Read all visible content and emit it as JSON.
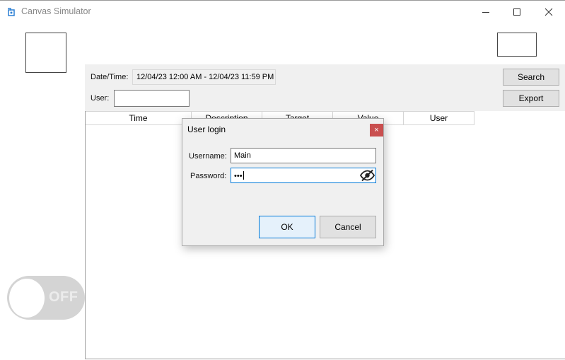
{
  "window": {
    "title": "Canvas Simulator",
    "icons": {
      "app": "app-icon",
      "minimize": "minimize-icon",
      "maximize": "maximize-icon",
      "close": "close-icon"
    }
  },
  "filters": {
    "datetime_label": "Date/Time:",
    "datetime_value": "12/04/23 12:00 AM - 12/04/23 11:59 PM",
    "user_label": "User:",
    "user_value": ""
  },
  "buttons": {
    "search": "Search",
    "export": "Export"
  },
  "table": {
    "columns": [
      "Time",
      "Description",
      "Target",
      "Value",
      "User"
    ],
    "rows": []
  },
  "toggle": {
    "label": "OFF",
    "state": "off"
  },
  "dialog": {
    "title": "User login",
    "close_glyph": "×",
    "username_label": "Username:",
    "username_value": "Main",
    "password_label": "Password:",
    "password_value": "•••",
    "eye_icon": "eye-slash-icon",
    "ok_label": "OK",
    "cancel_label": "Cancel"
  },
  "colors": {
    "dialog_close_bg": "#c94f4f",
    "focus_border": "#0078d7",
    "panel_bg": "#f0f0f0"
  }
}
